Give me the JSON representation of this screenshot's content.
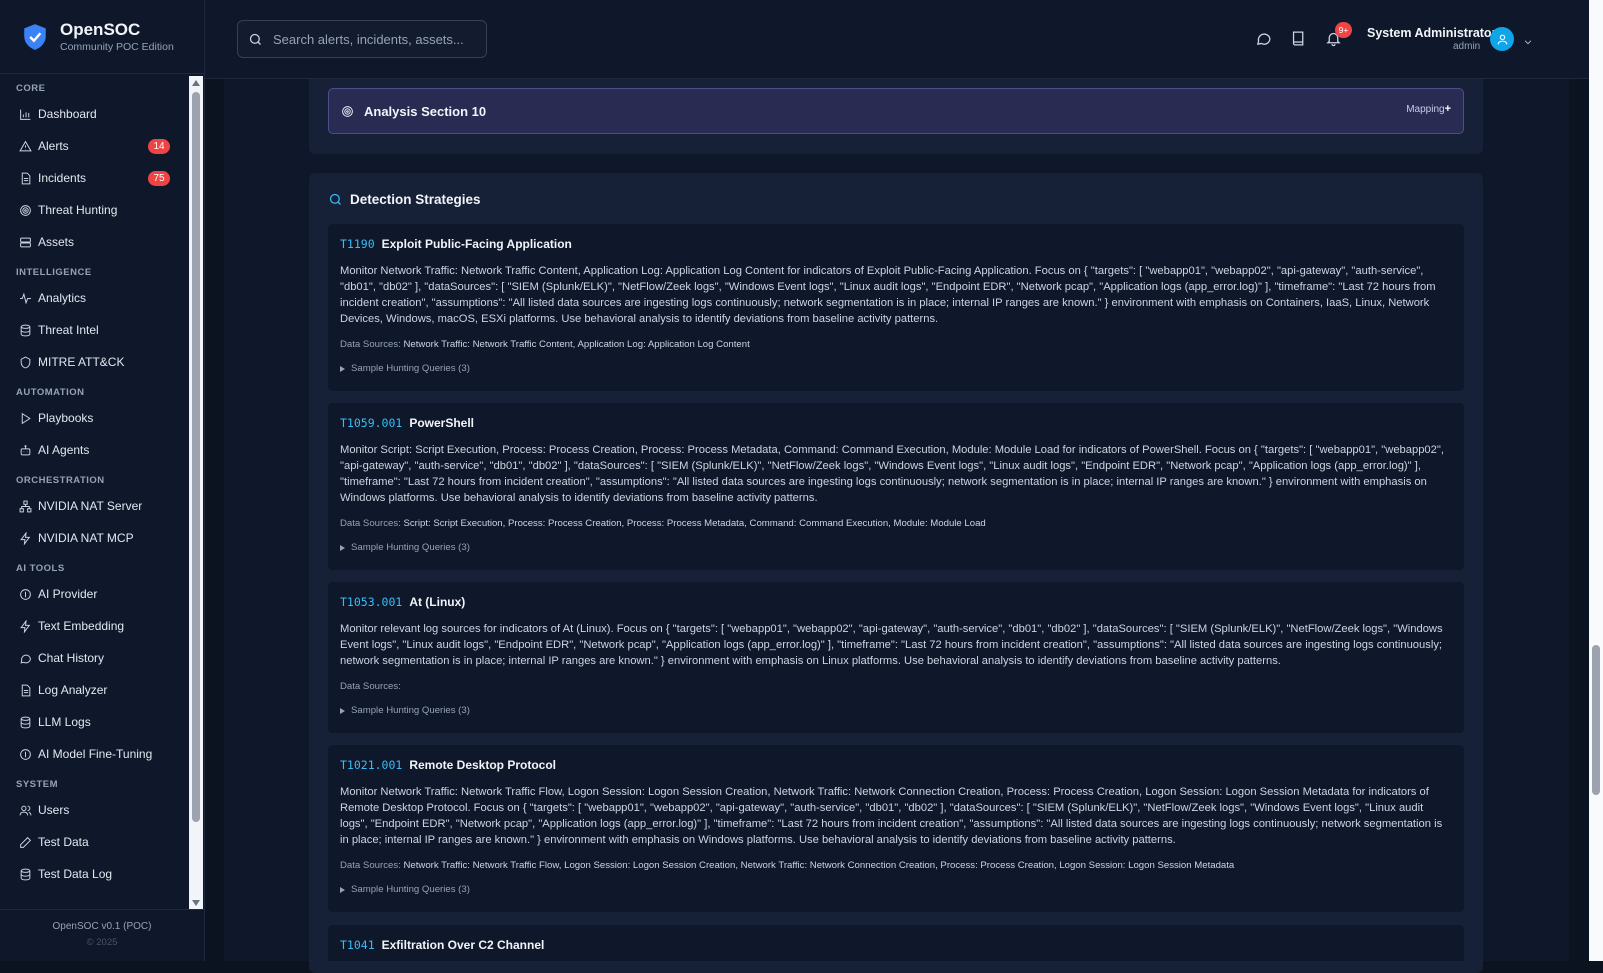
{
  "brand": {
    "title": "OpenSOC",
    "subtitle": "Community POC Edition"
  },
  "nav": {
    "core_label": "CORE",
    "core": [
      {
        "label": "Dashboard",
        "icon": "bar-chart-icon"
      },
      {
        "label": "Alerts",
        "icon": "alert-triangle-icon",
        "badge": "14"
      },
      {
        "label": "Incidents",
        "icon": "file-text-icon",
        "badge": "75"
      },
      {
        "label": "Threat Hunting",
        "icon": "target-icon"
      },
      {
        "label": "Assets",
        "icon": "server-icon"
      }
    ],
    "intel_label": "INTELLIGENCE",
    "intel": [
      {
        "label": "Analytics",
        "icon": "activity-icon"
      },
      {
        "label": "Threat Intel",
        "icon": "database-icon"
      },
      {
        "label": "MITRE ATT&CK",
        "icon": "shield-icon"
      }
    ],
    "auto_label": "AUTOMATION",
    "auto": [
      {
        "label": "Playbooks",
        "icon": "play-icon"
      },
      {
        "label": "AI Agents",
        "icon": "bot-icon"
      }
    ],
    "orch_label": "ORCHESTRATION",
    "orch": [
      {
        "label": "NVIDIA NAT Server",
        "icon": "network-icon"
      },
      {
        "label": "NVIDIA NAT MCP",
        "icon": "zap-icon"
      }
    ],
    "ai_label": "AI TOOLS",
    "ai": [
      {
        "label": "AI Provider",
        "icon": "cpu-icon"
      },
      {
        "label": "Text Embedding",
        "icon": "zap-icon"
      },
      {
        "label": "Chat History",
        "icon": "message-icon"
      },
      {
        "label": "Log Analyzer",
        "icon": "file-text-icon"
      },
      {
        "label": "LLM Logs",
        "icon": "database-icon"
      },
      {
        "label": "AI Model Fine-Tuning",
        "icon": "cpu-icon"
      }
    ],
    "sys_label": "SYSTEM",
    "sys": [
      {
        "label": "Users",
        "icon": "users-icon"
      },
      {
        "label": "Test Data",
        "icon": "pen-icon"
      },
      {
        "label": "Test Data Log",
        "icon": "database-icon"
      }
    ]
  },
  "footer": {
    "version": "OpenSOC v0.1 (POC)",
    "year": "© 2025"
  },
  "header": {
    "search_placeholder": "Search alerts, incidents, assets...",
    "notif_count": "9+",
    "user_name": "System Administrator",
    "user_role": "admin"
  },
  "analysis": {
    "title": "Analysis Section 10",
    "tag": "Mapping"
  },
  "detection": {
    "title": "Detection Strategies",
    "ds_label": "Data Sources:",
    "cards": [
      {
        "id": "T1190",
        "name": "Exploit Public-Facing Application",
        "desc": "Monitor Network Traffic: Network Traffic Content, Application Log: Application Log Content for indicators of Exploit Public-Facing Application. Focus on { \"targets\": [ \"webapp01\", \"webapp02\", \"api-gateway\", \"auth-service\", \"db01\", \"db02\" ], \"dataSources\": [ \"SIEM (Splunk/ELK)\", \"NetFlow/Zeek logs\", \"Windows Event logs\", \"Linux audit logs\", \"Endpoint EDR\", \"Network pcap\", \"Application logs (app_error.log)\" ], \"timeframe\": \"Last 72 hours from incident creation\", \"assumptions\": \"All listed data sources are ingesting logs continuously; network segmentation is in place; internal IP ranges are known.\" } environment with emphasis on Containers, IaaS, Linux, Network Devices, Windows, macOS, ESXi platforms. Use behavioral analysis to identify deviations from baseline activity patterns.",
        "sources": "Network Traffic: Network Traffic Content, Application Log: Application Log Content",
        "queries": "Sample Hunting Queries (3)"
      },
      {
        "id": "T1059.001",
        "name": "PowerShell",
        "desc": "Monitor Script: Script Execution, Process: Process Creation, Process: Process Metadata, Command: Command Execution, Module: Module Load for indicators of PowerShell. Focus on { \"targets\": [ \"webapp01\", \"webapp02\", \"api-gateway\", \"auth-service\", \"db01\", \"db02\" ], \"dataSources\": [ \"SIEM (Splunk/ELK)\", \"NetFlow/Zeek logs\", \"Windows Event logs\", \"Linux audit logs\", \"Endpoint EDR\", \"Network pcap\", \"Application logs (app_error.log)\" ], \"timeframe\": \"Last 72 hours from incident creation\", \"assumptions\": \"All listed data sources are ingesting logs continuously; network segmentation is in place; internal IP ranges are known.\" } environment with emphasis on Windows platforms. Use behavioral analysis to identify deviations from baseline activity patterns.",
        "sources": "Script: Script Execution, Process: Process Creation, Process: Process Metadata, Command: Command Execution, Module: Module Load",
        "queries": "Sample Hunting Queries (3)"
      },
      {
        "id": "T1053.001",
        "name": "At (Linux)",
        "desc": "Monitor relevant log sources for indicators of At (Linux). Focus on { \"targets\": [ \"webapp01\", \"webapp02\", \"api-gateway\", \"auth-service\", \"db01\", \"db02\" ], \"dataSources\": [ \"SIEM (Splunk/ELK)\", \"NetFlow/Zeek logs\", \"Windows Event logs\", \"Linux audit logs\", \"Endpoint EDR\", \"Network pcap\", \"Application logs (app_error.log)\" ], \"timeframe\": \"Last 72 hours from incident creation\", \"assumptions\": \"All listed data sources are ingesting logs continuously; network segmentation is in place; internal IP ranges are known.\" } environment with emphasis on Linux platforms. Use behavioral analysis to identify deviations from baseline activity patterns.",
        "sources": "",
        "queries": "Sample Hunting Queries (3)"
      },
      {
        "id": "T1021.001",
        "name": "Remote Desktop Protocol",
        "desc": "Monitor Network Traffic: Network Traffic Flow, Logon Session: Logon Session Creation, Network Traffic: Network Connection Creation, Process: Process Creation, Logon Session: Logon Session Metadata for indicators of Remote Desktop Protocol. Focus on { \"targets\": [ \"webapp01\", \"webapp02\", \"api-gateway\", \"auth-service\", \"db01\", \"db02\" ], \"dataSources\": [ \"SIEM (Splunk/ELK)\", \"NetFlow/Zeek logs\", \"Windows Event logs\", \"Linux audit logs\", \"Endpoint EDR\", \"Network pcap\", \"Application logs (app_error.log)\" ], \"timeframe\": \"Last 72 hours from incident creation\", \"assumptions\": \"All listed data sources are ingesting logs continuously; network segmentation is in place; internal IP ranges are known.\" } environment with emphasis on Windows platforms. Use behavioral analysis to identify deviations from baseline activity patterns.",
        "sources": "Network Traffic: Network Traffic Flow, Logon Session: Logon Session Creation, Network Traffic: Network Connection Creation, Process: Process Creation, Logon Session: Logon Session Metadata",
        "queries": "Sample Hunting Queries (3)"
      },
      {
        "id": "T1041",
        "name": "Exfiltration Over C2 Channel"
      }
    ]
  },
  "colors": {
    "accent": "#38bdf8",
    "badge": "#ef4444",
    "analysis_bg": "#2a2b52"
  }
}
